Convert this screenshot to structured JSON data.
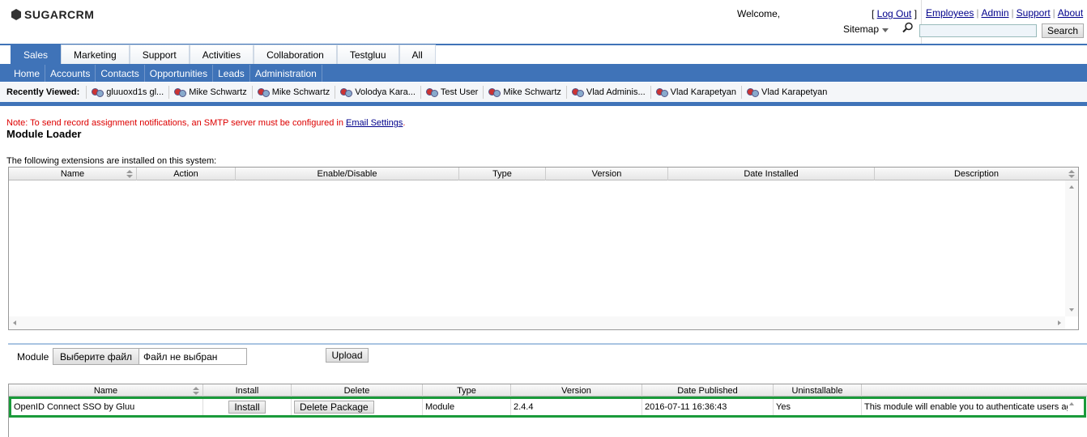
{
  "header": {
    "logo": "SUGARCRM",
    "welcome": "Welcome,",
    "logout": "Log Out",
    "top_links": [
      "Employees",
      "Admin",
      "Support",
      "About"
    ],
    "sitemap": "Sitemap",
    "search_button": "Search",
    "search_value": ""
  },
  "group_tabs": [
    "Sales",
    "Marketing",
    "Support",
    "Activities",
    "Collaboration",
    "Testgluu",
    "All"
  ],
  "sub_tabs": [
    "Home",
    "Accounts",
    "Contacts",
    "Opportunities",
    "Leads",
    "Administration"
  ],
  "recently_viewed": {
    "label": "Recently Viewed:",
    "items": [
      "gluuoxd1s gl...",
      "Mike Schwartz",
      "Mike Schwartz",
      "Volodya Kara...",
      "Test User",
      "Mike Schwartz",
      "Vlad Adminis...",
      "Vlad Karapetyan",
      "Vlad Karapetyan"
    ]
  },
  "note": {
    "text": "Note: To send record assignment notifications, an SMTP server must be configured in ",
    "link": "Email Settings",
    "end": "."
  },
  "page_title": "Module Loader",
  "installed": {
    "caption": "The following extensions are installed on this system:",
    "columns": [
      "Name",
      "Action",
      "Enable/Disable",
      "Type",
      "Version",
      "Date Installed",
      "Description"
    ]
  },
  "upload": {
    "module_label": "Module",
    "file_button": "Выберите файл",
    "file_status": "Файл не выбран",
    "upload_button": "Upload"
  },
  "packages": {
    "columns": [
      "Name",
      "Install",
      "Delete",
      "Type",
      "Version",
      "Date Published",
      "Uninstallable",
      ""
    ],
    "row": {
      "name": "OpenID Connect SSO by Gluu",
      "install": "Install",
      "delete": "Delete Package",
      "type": "Module",
      "version": "2.4.4",
      "date": "2016-07-11 16:36:43",
      "uninstallable": "Yes",
      "description": "This module will enable you to authenticate users ag"
    }
  },
  "colors": {
    "nav_blue": "#3f73b8",
    "highlight_green": "#1a9a3a",
    "note_red": "#dd0000"
  }
}
